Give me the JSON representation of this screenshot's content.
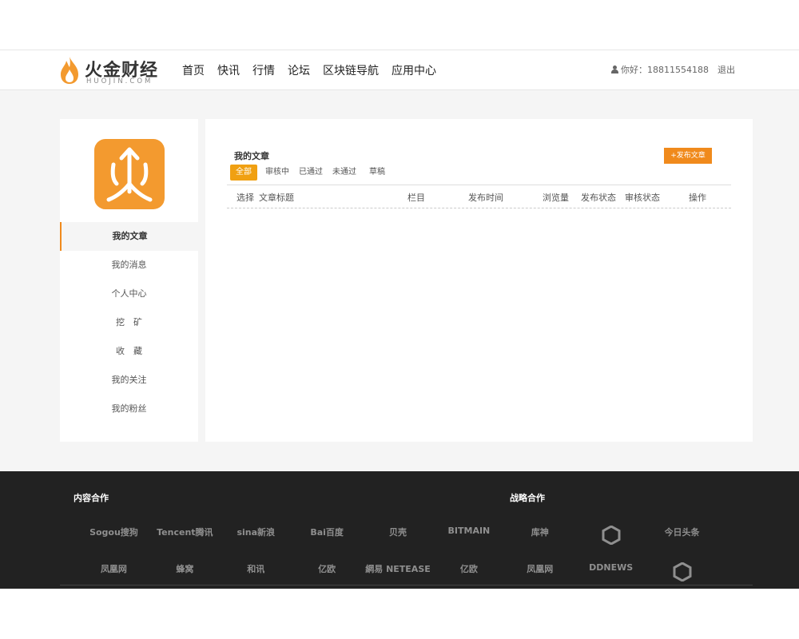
{
  "header": {
    "logo": {
      "brand": "火金财经",
      "sub": "HUOJIN.COM"
    },
    "nav": [
      "首页",
      "快讯",
      "行情",
      "论坛",
      "区块链导航",
      "应用中心"
    ],
    "user": {
      "greeting": "你好：18811554188",
      "logout": "退出"
    }
  },
  "sidebar": {
    "menu": [
      "我的文章",
      "我的消息",
      "个人中心",
      "挖　矿",
      "收　藏",
      "我的关注",
      "我的粉丝"
    ],
    "active_index": 0
  },
  "content": {
    "title": "我的文章",
    "publish_button": "+发布文章",
    "tabs": [
      "全部",
      "审核中",
      "已通过",
      "未通过",
      "草稿"
    ],
    "active_tab": 0,
    "columns": [
      "选择",
      "文章标题",
      "栏目",
      "发布时间",
      "浏览量",
      "发布状态",
      "审核状态",
      "操作"
    ],
    "rows": []
  },
  "footer": {
    "content_partners_title": "内容合作",
    "strategic_partners_title": "战略合作",
    "logos_row1": [
      "Sogou搜狗",
      "Tencent腾讯",
      "sina新浪",
      "Bai百度",
      "贝壳",
      "BITMAIN",
      "库神",
      "",
      "今日头条"
    ],
    "logos_row2": [
      "凤凰网",
      "蜂窝",
      "和讯",
      "亿欧",
      "網易 NETEASE",
      "亿欧",
      "凤凰网",
      "DDNEWS",
      ""
    ]
  },
  "colors": {
    "accent": "#f08a1c",
    "tab_active": "#f0a012",
    "footer_bg": "#222222",
    "page_bg": "#f5f5f5"
  },
  "icons": {
    "logo": "flame-icon",
    "user": "person-icon",
    "avatar": "fire-character-icon"
  }
}
